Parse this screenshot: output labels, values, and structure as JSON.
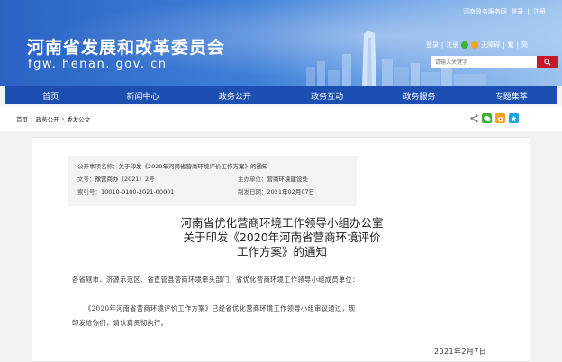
{
  "topbar": {
    "service": "河南政务服务网",
    "login": "登录",
    "sep": "|",
    "register": "注册"
  },
  "site": {
    "title": "河南省发展和改革委员会",
    "domain": "fgw. henan. gov. cn"
  },
  "accessibility": {
    "login": "登录",
    "register": "注册",
    "accessible": "无障碍",
    "simplified": "繁",
    "traditional": "简",
    "sep": "|"
  },
  "search": {
    "placeholder": "请输入关键字"
  },
  "nav": {
    "items": [
      "首页",
      "新闻中心",
      "政务公开",
      "政务互动",
      "政务服务",
      "专题集萃"
    ]
  },
  "breadcrumb": {
    "items": [
      "首页",
      "政务公开",
      "委发公文"
    ],
    "sep": "›"
  },
  "meta": {
    "category_label": "公开事项名称：",
    "category_value": "关于印发《2020年河南省营商环境评价工作方案》的通知",
    "doc_no_label": "文号：",
    "doc_no_value": "豫营商办〔2021〕2号",
    "issuer_label": "主办单位：",
    "issuer_value": "营商环境建设处",
    "index_label": "索引号：",
    "index_value": "10010-0100-2021-00001",
    "date_label": "制发日期：",
    "date_value": "2021年02月07日"
  },
  "article": {
    "title_line1": "河南省优化营商环境工作领导小组办公室",
    "title_line2": "关于印发《2020年河南省营商环境评价",
    "title_line3": "工作方案》的通知",
    "salutation": "各省辖市、济源示范区、省直管县营商环境牵头部门，省优化营商环境工作领导小组成员单位：",
    "para1_line1": "《2020年河南省营商环境评价工作方案》已经省优化营商环境工作领导小组审议通过，现",
    "para1_line2": "印发给你们，请认真贯彻执行。",
    "date": "2021年2月7日"
  },
  "colors": {
    "nav": "#1d4fb3",
    "search_button": "#c8172b",
    "wechat": "#3eb135",
    "weibo": "#f4a21b",
    "qzone": "#19a4e6"
  }
}
